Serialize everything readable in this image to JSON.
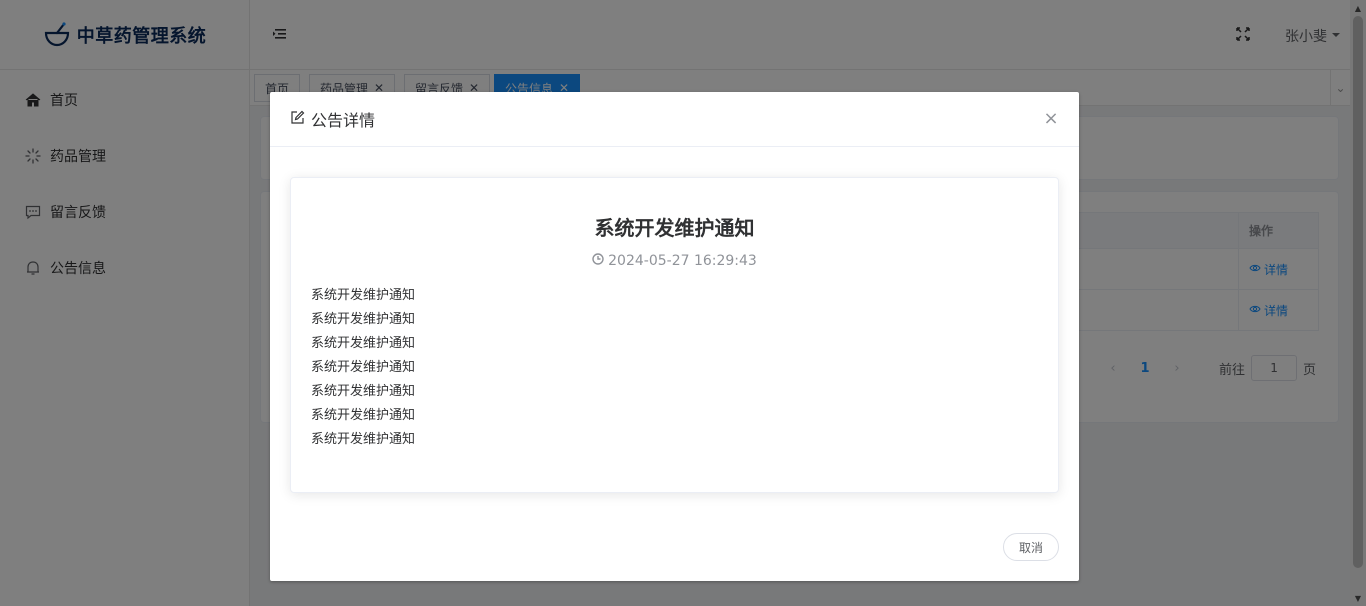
{
  "app": {
    "logo_text": "中草药管理系统"
  },
  "sidebar": {
    "items": [
      {
        "label": "首页",
        "icon": "home-icon"
      },
      {
        "label": "药品管理",
        "icon": "loading-icon"
      },
      {
        "label": "留言反馈",
        "icon": "chat-icon"
      },
      {
        "label": "公告信息",
        "icon": "bell-icon"
      }
    ]
  },
  "header": {
    "username": "张小斐"
  },
  "tabs": [
    {
      "label": "首页",
      "closable": false,
      "active": false
    },
    {
      "label": "药品管理",
      "closable": true,
      "active": false
    },
    {
      "label": "留言反馈",
      "closable": true,
      "active": false
    },
    {
      "label": "公告信息",
      "closable": true,
      "active": true
    }
  ],
  "table": {
    "op_header": "操作",
    "rows": [
      {
        "op_label": "详情"
      },
      {
        "op_label": "详情"
      }
    ]
  },
  "pagination": {
    "current": "1",
    "goto_label": "前往",
    "goto_value": "1",
    "page_suffix": "页"
  },
  "modal": {
    "title": "公告详情",
    "detail": {
      "title": "系统开发维护通知",
      "time": "2024-05-27 16:29:43",
      "lines": [
        "系统开发维护通知",
        "系统开发维护通知",
        "系统开发维护通知",
        "系统开发维护通知",
        "系统开发维护通知",
        "系统开发维护通知",
        "系统开发维护通知"
      ]
    },
    "cancel_label": "取消"
  },
  "colors": {
    "primary": "#1890ff",
    "logo": "#0a2a5a"
  }
}
